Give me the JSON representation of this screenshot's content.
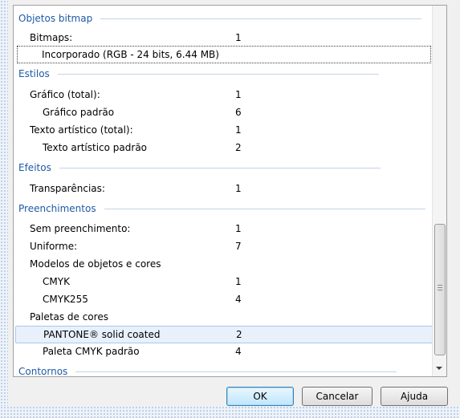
{
  "sections": [
    {
      "title": "Objetos bitmap",
      "rows": [
        {
          "label": "Bitmaps:",
          "value": "1"
        },
        {
          "label": "Incorporado (RGB - 24 bits, 6.44 MB)",
          "value": ""
        }
      ]
    },
    {
      "title": "Estilos",
      "rows": [
        {
          "label": "Gráfico (total):",
          "value": "1"
        },
        {
          "label": "Gráfico padrão",
          "value": "6"
        },
        {
          "label": "Texto artístico (total):",
          "value": "1"
        },
        {
          "label": "Texto artístico padrão",
          "value": "2"
        }
      ]
    },
    {
      "title": "Efeitos",
      "rows": [
        {
          "label": "Transparências:",
          "value": "1"
        }
      ]
    },
    {
      "title": "Preenchimentos",
      "rows": [
        {
          "label": "Sem preenchimento:",
          "value": "1"
        },
        {
          "label": "Uniforme:",
          "value": "7"
        },
        {
          "label": "Modelos de objetos e cores",
          "value": ""
        },
        {
          "label": "CMYK",
          "value": "1"
        },
        {
          "label": "CMYK255",
          "value": "4"
        },
        {
          "label": "Paletas de cores",
          "value": ""
        },
        {
          "label": "PANTONE® solid coated",
          "value": "2"
        },
        {
          "label": "Paleta CMYK padrão",
          "value": "4"
        }
      ]
    },
    {
      "title": "Contornos",
      "rows": []
    }
  ],
  "buttons": {
    "ok": "OK",
    "cancel": "Cancelar",
    "help": "Ajuda"
  },
  "colors": {
    "section_header": "#1e5aa8",
    "hover_row": "#e8f1fb"
  }
}
